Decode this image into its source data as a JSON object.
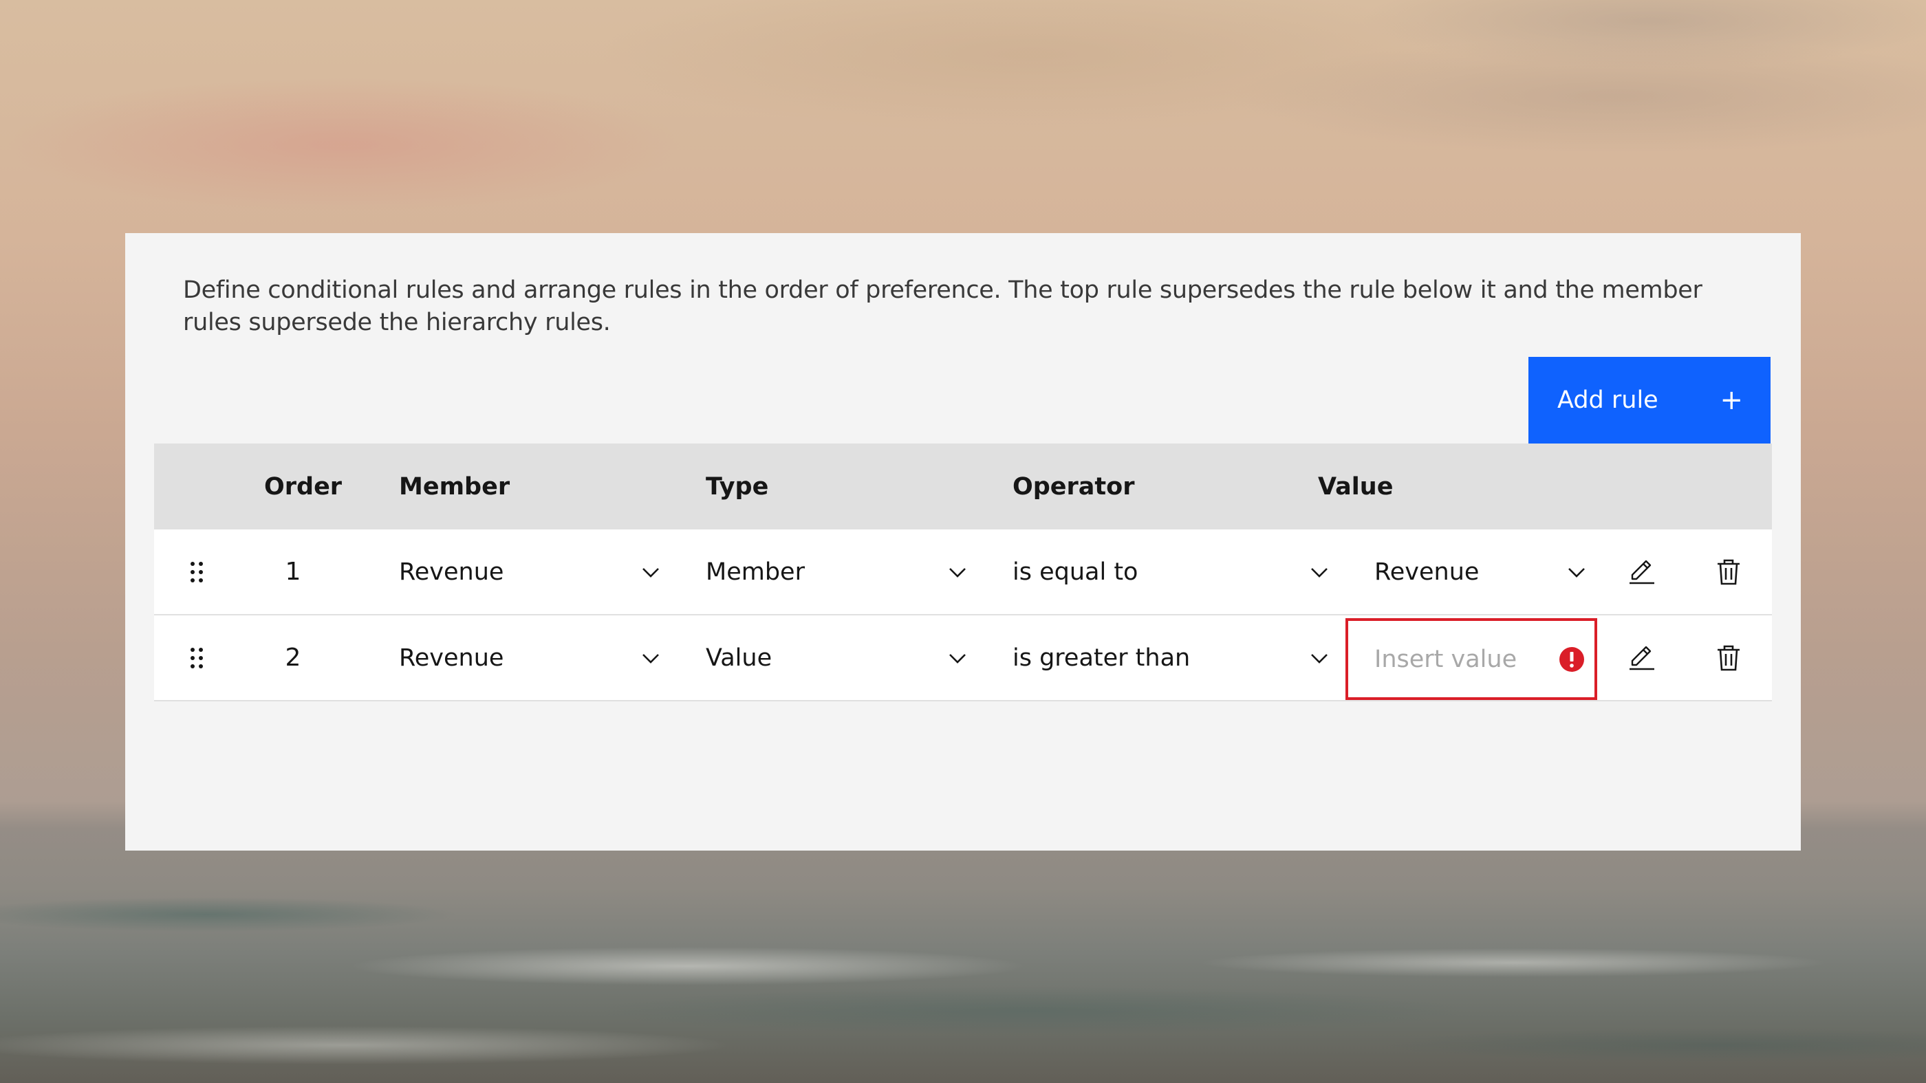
{
  "description": "Define conditional rules and arrange rules in the order of preference. The top rule supersedes the rule below it and the member rules supersede the hierarchy rules.",
  "add_button": {
    "label": "Add rule",
    "icon": "plus-icon"
  },
  "columns": {
    "order": "Order",
    "member": "Member",
    "type": "Type",
    "operator": "Operator",
    "value": "Value"
  },
  "rows": [
    {
      "order": "1",
      "member": "Revenue",
      "type": "Member",
      "operator": "is equal to",
      "value": "Revenue"
    },
    {
      "order": "2",
      "member": "Revenue",
      "type": "Value",
      "operator": "is greater than",
      "value_placeholder": "Insert value",
      "value_error": true
    }
  ],
  "colors": {
    "primary": "#0f62fe",
    "error": "#da1e28",
    "header_bg": "#e0e0e0",
    "panel_bg": "#f4f4f4"
  }
}
